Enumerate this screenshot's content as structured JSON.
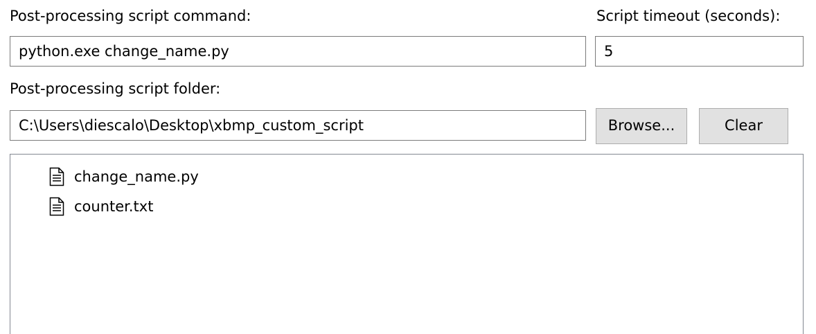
{
  "command": {
    "label": "Post-processing script command:",
    "value": "python.exe change_name.py"
  },
  "timeout": {
    "label": "Script timeout (seconds):",
    "value": "5"
  },
  "folder": {
    "label": "Post-processing script folder:",
    "value": "C:\\Users\\diescalo\\Desktop\\xbmp_custom_script",
    "browse_label": "Browse...",
    "clear_label": "Clear"
  },
  "files": [
    {
      "name": "change_name.py",
      "icon": "document-icon"
    },
    {
      "name": "counter.txt",
      "icon": "document-icon"
    }
  ]
}
